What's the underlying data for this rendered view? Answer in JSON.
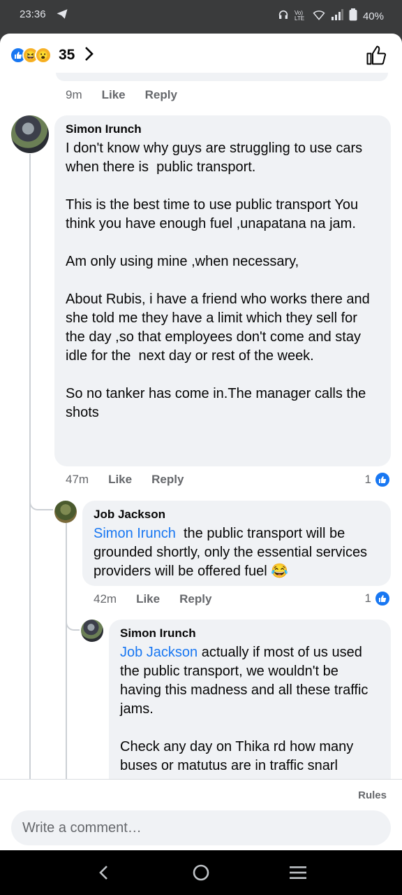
{
  "status_bar": {
    "time": "23:36",
    "network_label": "Vo) LTE",
    "battery": "40%"
  },
  "reactions": {
    "count": "35",
    "icons": [
      "like-icon",
      "haha-icon",
      "wow-icon"
    ]
  },
  "previous_comment": {
    "time": "9m",
    "like_label": "Like",
    "reply_label": "Reply"
  },
  "comments": [
    {
      "author": "Simon Irunch",
      "text": "I don't know why guys are struggling to use cars when there is  public transport.\n\nThis is the best time to use public transport You think you have enough fuel ,unapatana na jam.\n\nAm only using mine ,when necessary,\n\nAbout Rubis, i have a friend who works there and she told me they have a limit which they sell for the day ,so that employees don't come and stay idle for the  next day or rest of the week.\n\nSo no tanker has come in.The manager calls the shots",
      "time": "47m",
      "like_label": "Like",
      "reply_label": "Reply",
      "reactions": "1"
    },
    {
      "author": "Job Jackson",
      "mention": "Simon Irunch",
      "text": "  the public transport will be grounded shortly, only the essential services providers will be offered fuel 😂",
      "time": "42m",
      "like_label": "Like",
      "reply_label": "Reply",
      "reactions": "1"
    },
    {
      "author": "Simon Irunch",
      "mention": "Job Jackson",
      "text": " actually if most of us used the public transport, we wouldn't be having this madness and all these traffic jams.\n\nCheck any day on Thika rd how many buses or matutus are in traffic snarl"
    }
  ],
  "footer": {
    "rules_label": "Rules",
    "input_placeholder": "Write a comment…"
  },
  "colors": {
    "accent": "#1877f2",
    "bubble": "#f0f2f5",
    "meta": "#65676b"
  }
}
